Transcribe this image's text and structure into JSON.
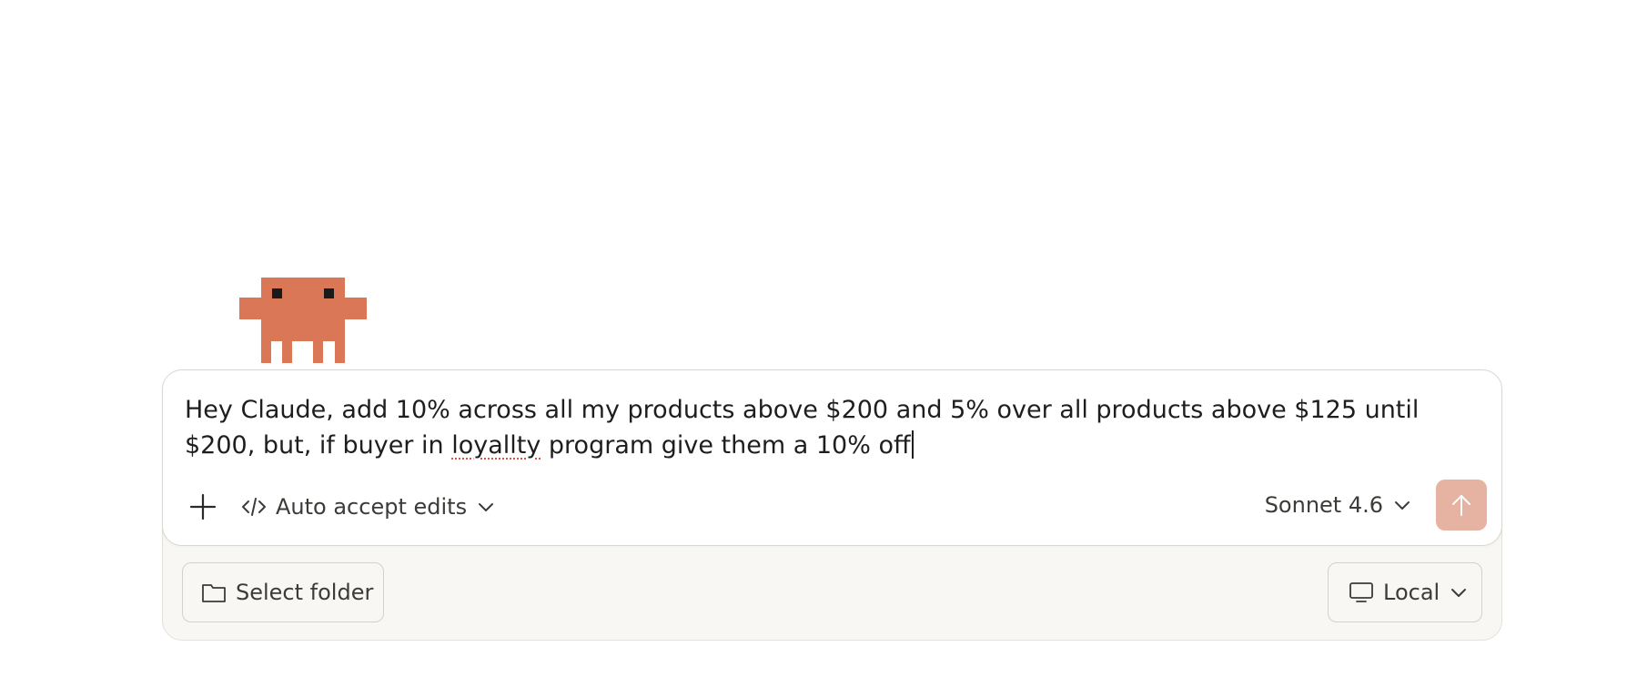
{
  "composer": {
    "prompt_before_typo": "Hey Claude, add 10% across all my products above $200 and 5% over all products above $125 until $200, but, if buyer in ",
    "prompt_typo_word": "loyallty",
    "prompt_after_typo": " program give them a 10% off",
    "mode_label": "Auto accept edits",
    "model_label": "Sonnet 4.6"
  },
  "tray": {
    "folder_label": "Select folder",
    "environment_label": "Local"
  },
  "icons": {
    "add": "plus-icon",
    "mode": "code-icon",
    "send": "arrow-up-icon",
    "folder": "folder-icon",
    "environment": "monitor-icon",
    "dropdown": "chevron-down-icon",
    "mascot": "pixel-crab-mascot"
  },
  "colors": {
    "mascot": "#d97757",
    "mascot_eyes": "#1a1a1a",
    "send_button": "#e6b2a2",
    "tray_background": "#f8f7f4",
    "spellcheck_underline": "#d9534f"
  }
}
